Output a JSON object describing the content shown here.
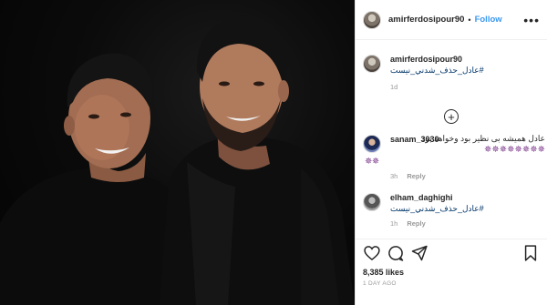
{
  "post": {
    "author": "amirferdosipour90",
    "follow_label": "Follow",
    "more_label": "•••",
    "caption": {
      "username": "amirferdosipour90",
      "hashtag": "#عادل_حذف_شدني_نيست",
      "time": "1d"
    },
    "load_more_label": "+",
    "comments": [
      {
        "username": "sanam_3030",
        "text": "عادل همیشه بی نظیر بود وخواهد بود",
        "stars_line1": "✵✵✵✵✵✵✵✵",
        "stars_line2": "✵✵",
        "time": "3h",
        "reply_label": "Reply",
        "avatar": "user-sanam"
      },
      {
        "username": "elham_daghighi",
        "text": "#عادل_حذف_شدني_نيست",
        "time": "1h",
        "reply_label": "Reply",
        "avatar": "user-elham"
      }
    ],
    "likes": "8,385 likes",
    "age": "1 DAY AGO"
  },
  "icons": {
    "like": "heart-icon",
    "comment": "comment-bubble-icon",
    "share": "share-icon",
    "save": "bookmark-icon"
  },
  "colors": {
    "link": "#3897f0",
    "hashtag": "#003569",
    "secondary_text": "#999999",
    "text": "#262626",
    "photo_bg": "#000000"
  }
}
